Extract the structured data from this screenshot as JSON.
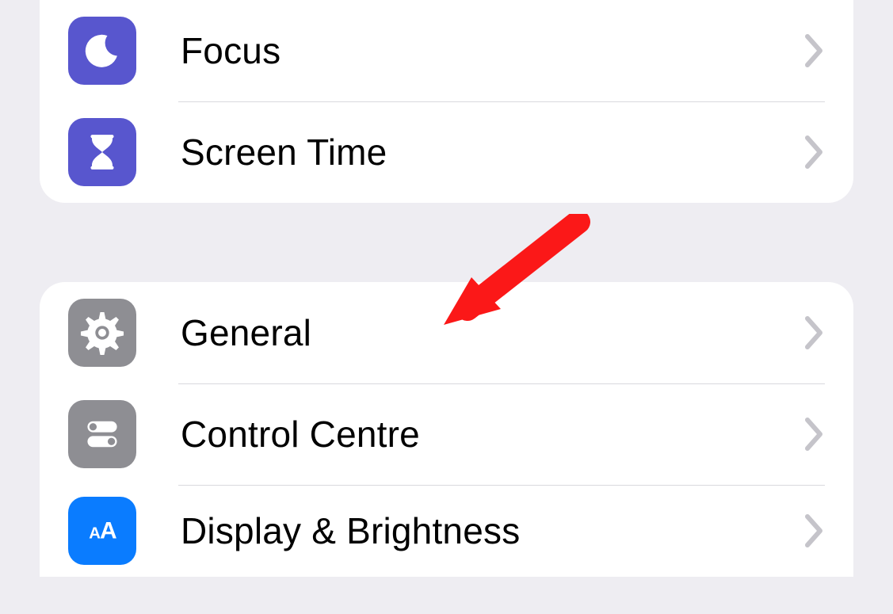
{
  "colors": {
    "purple": "#5856ce",
    "gray": "#8e8e93",
    "blue": "#0a7cff",
    "arrow": "#fb1818",
    "chevron": "#c5c4ca"
  },
  "groups": [
    {
      "id": "group1",
      "items": [
        {
          "id": "focus",
          "label": "Focus",
          "icon": "moon-icon",
          "bg": "purple"
        },
        {
          "id": "screentime",
          "label": "Screen Time",
          "icon": "hourglass-icon",
          "bg": "purple"
        }
      ]
    },
    {
      "id": "group2",
      "items": [
        {
          "id": "general",
          "label": "General",
          "icon": "gear-icon",
          "bg": "gray"
        },
        {
          "id": "controlcentre",
          "label": "Control Centre",
          "icon": "toggles-icon",
          "bg": "gray"
        },
        {
          "id": "displaybrightness",
          "label": "Display & Brightness",
          "icon": "text-size-icon",
          "bg": "blue"
        }
      ]
    }
  ]
}
